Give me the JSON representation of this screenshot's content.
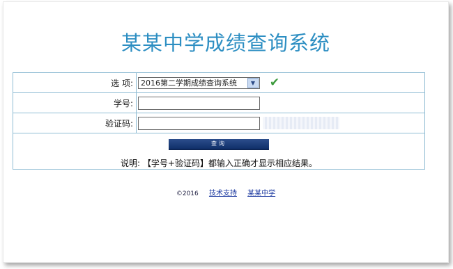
{
  "page": {
    "title": "某某中学成绩查询系统"
  },
  "form": {
    "option_label": "选 项:",
    "option_selected": "2016第二学期成绩查询系统",
    "student_id_label": "学号:",
    "student_id_value": "",
    "captcha_label": "验证码:",
    "captcha_value": "",
    "submit_label": "查询",
    "note": "说明: 【学号+验证码】都输入正确才显示相应结果。"
  },
  "footer": {
    "copyright": "©2016",
    "link_support": "技术支持",
    "link_school": "某某中学"
  },
  "colors": {
    "title": "#2c8ec2",
    "table_border": "#8fbcd3",
    "check": "#3c9a3c",
    "button": "#1b3c7a",
    "link": "#1d3aa0"
  },
  "icons": {
    "dropdown": "chevron-down-icon",
    "valid": "checkmark-icon"
  }
}
